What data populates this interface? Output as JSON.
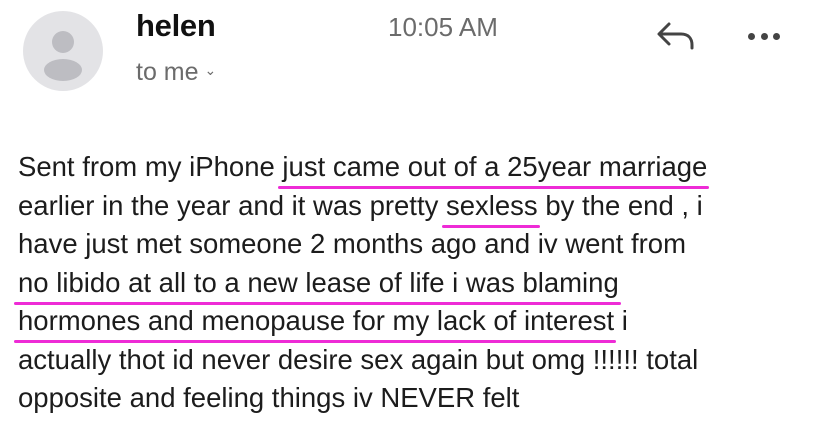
{
  "email": {
    "sender": "helen",
    "recipient": "to me",
    "time": "10:05 AM",
    "icons": {
      "avatar": "person-silhouette-icon",
      "recipient_chevron": "chevron-down-icon",
      "reply": "reply-arrow-icon",
      "more": "more-horizontal-icon"
    },
    "body_lines": [
      [
        "Sent from my iPhone ",
        "just came out of a 25year marriage"
      ],
      [
        "earlier in the year and it was pretty ",
        "sexless",
        " by the end , i"
      ],
      [
        "have just met someone 2 months ago and iv went from"
      ],
      [
        "no libido at all to a new  lease of life i was blaming"
      ],
      [
        "hormones and menopause for my lack of interest",
        " i"
      ],
      [
        "actually thot id never desire sex again but omg !!!!!! total"
      ],
      [
        "opposite and feeling things iv NEVER felt"
      ]
    ]
  },
  "colors": {
    "underline": "#ee2bd6",
    "avatar_bg": "#e3e3e6",
    "avatar_fg": "#bdbdc2",
    "muted_text": "#6b6b6b"
  }
}
